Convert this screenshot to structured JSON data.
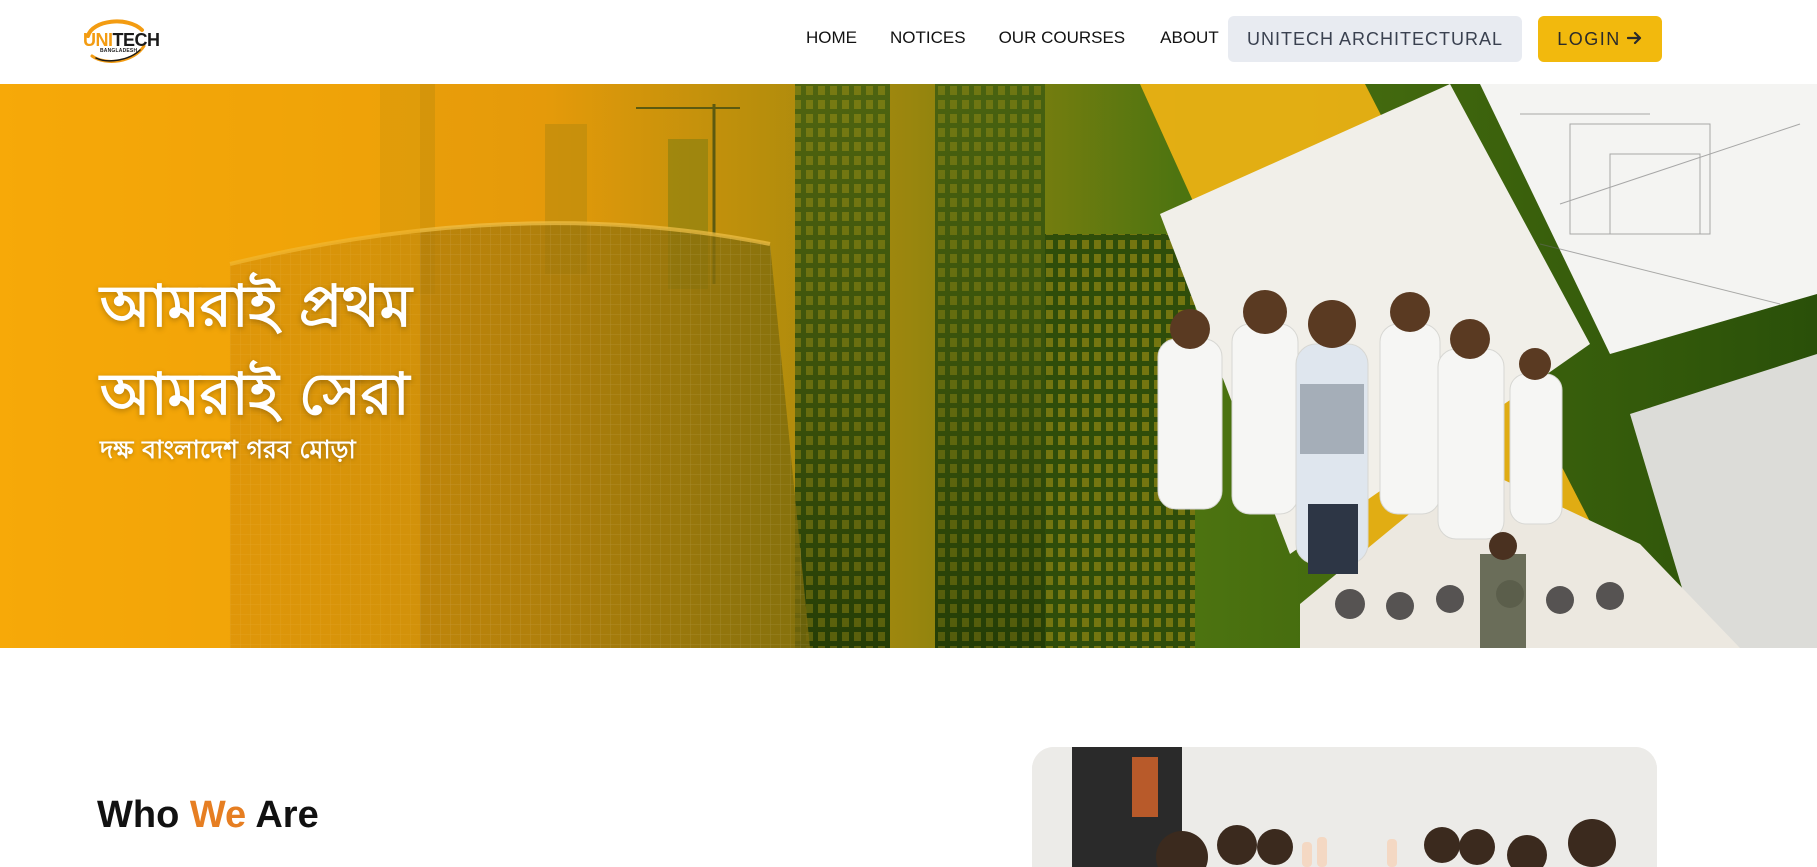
{
  "logo": {
    "brand_part1": "UNI",
    "brand_part2": "TECH",
    "tagline": "BANGLADESH",
    "colors": {
      "accent": "#f39c12",
      "dark": "#1a1a1a"
    }
  },
  "nav": {
    "items": [
      {
        "label": "HOME"
      },
      {
        "label": "NOTICES"
      },
      {
        "label": "OUR COURSES"
      },
      {
        "label": "ABOUT"
      }
    ],
    "architectural_button": "UNITECH ARCHITECTURAL",
    "login_button": "LOGIN",
    "login_icon": "arrow-right-icon"
  },
  "hero": {
    "title_line1": "আমরাই প্রথম",
    "title_line2": "আমরাই সেরা",
    "subtitle": "দক্ষ বাংলাদেশ গরব মোড়া",
    "colors": {
      "orange": "#f5a30a",
      "green": "#2f5a0c"
    }
  },
  "about": {
    "title_part1": "Who",
    "title_accent": "We",
    "title_part2": "Are",
    "accent_color": "#e67e22"
  }
}
